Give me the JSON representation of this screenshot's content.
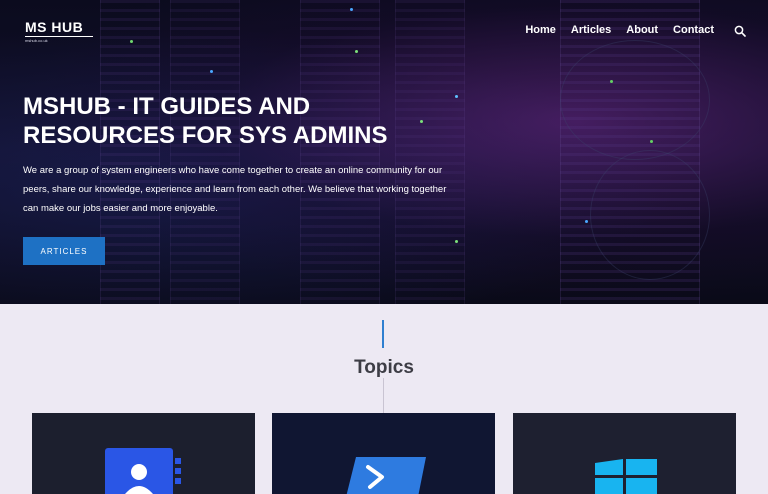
{
  "brand": {
    "name": "MS HUB",
    "sub": "mshub.co.uk"
  },
  "nav": {
    "items": [
      {
        "label": "Home"
      },
      {
        "label": "Articles"
      },
      {
        "label": "About"
      },
      {
        "label": "Contact"
      }
    ],
    "search_icon": "search-icon"
  },
  "hero": {
    "title_line1": "MSHUB - IT GUIDES AND",
    "title_line2": "RESOURCES FOR SYS ADMINS",
    "text": "We are a group of system engineers who have come together to create an online community for our peers, share our knowledge, experience and learn from each other. We believe that working together can make our jobs easier and more enjoyable.",
    "button_label": "ARTICLES"
  },
  "topics": {
    "title": "Topics",
    "cards": [
      {
        "icon": "contacts-book-icon"
      },
      {
        "icon": "powershell-icon"
      },
      {
        "icon": "windows-logo-icon"
      }
    ]
  },
  "colors": {
    "accent": "#1e71c4",
    "section_bg": "#ede9f3",
    "title_text": "#3d3d45"
  }
}
